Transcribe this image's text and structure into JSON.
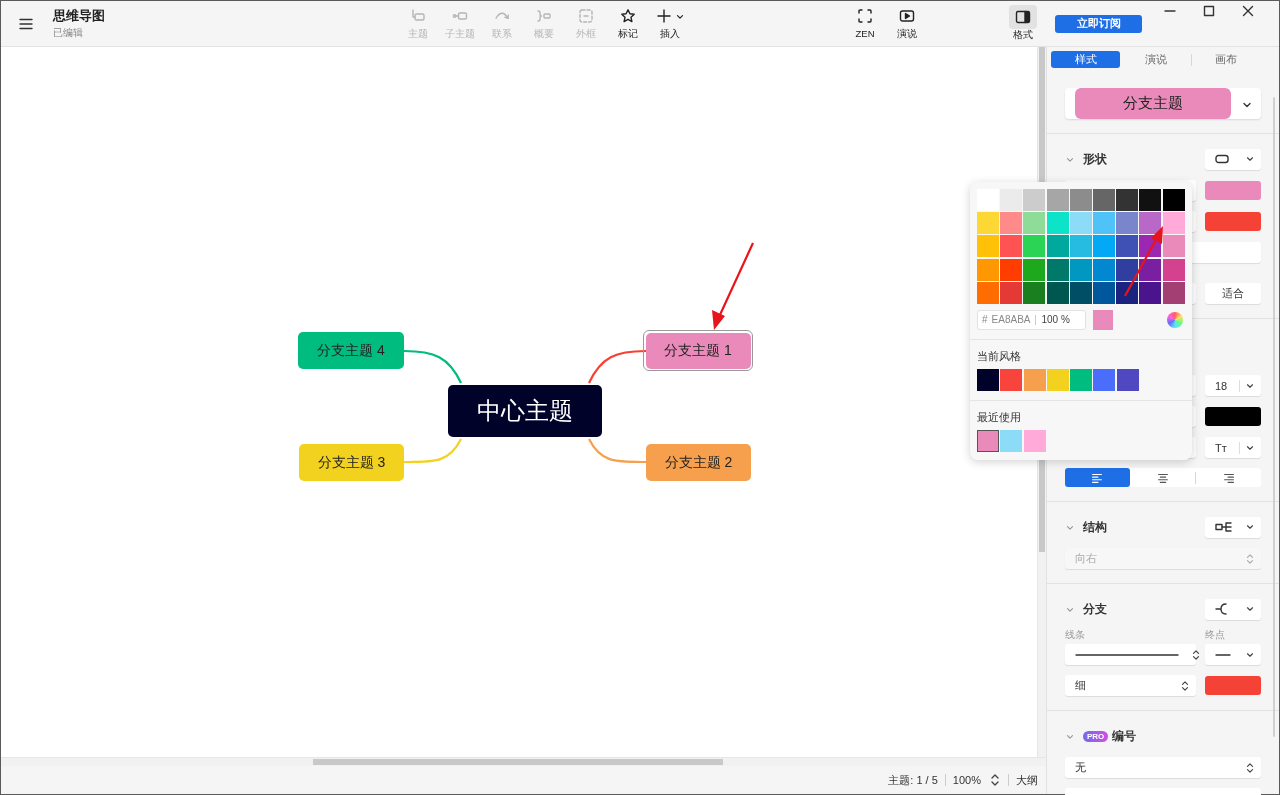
{
  "window": {
    "title": "思维导图",
    "subtitle": "已编辑"
  },
  "toolbar": [
    {
      "kind": "topic",
      "label": "主题",
      "disabled": true
    },
    {
      "kind": "subtopic",
      "label": "子主题",
      "disabled": true
    },
    {
      "kind": "relation",
      "label": "联系",
      "disabled": true
    },
    {
      "kind": "summary",
      "label": "概要",
      "disabled": true
    },
    {
      "kind": "boundary",
      "label": "外框",
      "disabled": true
    },
    {
      "kind": "marker",
      "label": "标记",
      "disabled": false
    },
    {
      "kind": "insert",
      "label": "插入",
      "disabled": false
    }
  ],
  "view_tools": [
    {
      "kind": "zen",
      "label": "ZEN"
    },
    {
      "kind": "present",
      "label": "演说"
    }
  ],
  "format_toggle": {
    "label": "格式",
    "on": true
  },
  "subscribe_button": "立即订阅",
  "canvas": {
    "central_topic": "中心主题",
    "branches": [
      {
        "text": "分支主题 4",
        "color": "#00bc7e",
        "line": {
          "color": "#00bc7e"
        },
        "selected": false
      },
      {
        "text": "分支主题 1",
        "color": "#ea8aba",
        "line": {
          "color": "#f44336"
        },
        "selected": true
      },
      {
        "text": "分支主题 3",
        "color": "#f2d21f",
        "line": {
          "color": "#f2d21f"
        },
        "selected": false
      },
      {
        "text": "分支主题 2",
        "color": "#f6a04d",
        "line": {
          "color": "#f6a04d"
        },
        "selected": false
      }
    ]
  },
  "status_bar": {
    "topics": "主题: 1 / 5",
    "zoom": "100%",
    "outline": "大纲"
  },
  "panel": {
    "tabs": [
      {
        "label": "样式",
        "selected": true
      },
      {
        "label": "演说",
        "selected": false
      },
      {
        "label": "画布",
        "selected": false
      }
    ],
    "preview": {
      "text": "分支主题",
      "color": "#ea8aba"
    },
    "shape": {
      "title": "形状",
      "fill": {
        "color": "#ea8aba"
      },
      "border": {
        "color": "#f44336"
      },
      "fit": "适合"
    },
    "text": {
      "size": "18",
      "color": "#000000",
      "case_label": "Tт"
    },
    "align": [
      {
        "kind": "left",
        "selected": true
      },
      {
        "kind": "center",
        "selected": false
      },
      {
        "kind": "right",
        "selected": false
      }
    ],
    "structure": {
      "title": "结构",
      "direction": "向右",
      "disabled": true
    },
    "branch": {
      "title": "分支",
      "line_label": "线条",
      "end_label": "终点",
      "weight": "细",
      "color": "#f44336"
    },
    "numbering": {
      "title": "编号",
      "badge": "PRO",
      "value": "无"
    }
  },
  "color_picker": {
    "grid": [
      [
        {
          "color": "#ffffff"
        },
        {
          "color": "#ebebeb"
        },
        {
          "color": "#cccccc"
        },
        {
          "color": "#a6a6a6"
        },
        {
          "color": "#8c8c8c"
        },
        {
          "color": "#666666"
        },
        {
          "color": "#333333"
        },
        {
          "color": "#111111"
        },
        {
          "color": "#000000"
        }
      ],
      [
        {
          "color": "#fdd835"
        },
        {
          "color": "#ff8a8a"
        },
        {
          "color": "#8fdc98"
        },
        {
          "color": "#0de3c8"
        },
        {
          "color": "#8ddcf7"
        },
        {
          "color": "#4fc3f7"
        },
        {
          "color": "#7986cb"
        },
        {
          "color": "#ba68c8"
        },
        {
          "color": "#ffaad8"
        }
      ],
      [
        {
          "color": "#ffc107"
        },
        {
          "color": "#ff5252"
        },
        {
          "color": "#2bd454"
        },
        {
          "color": "#00a99d"
        },
        {
          "color": "#26bbe0"
        },
        {
          "color": "#03a9f4"
        },
        {
          "color": "#3f51b5"
        },
        {
          "color": "#9c27b0"
        },
        {
          "color": "#ea8aba"
        }
      ],
      [
        {
          "color": "#ff9800"
        },
        {
          "color": "#ff3d00"
        },
        {
          "color": "#1ea81e"
        },
        {
          "color": "#00796b"
        },
        {
          "color": "#0097c1"
        },
        {
          "color": "#0288d1"
        },
        {
          "color": "#303f9f"
        },
        {
          "color": "#7b1fa2"
        },
        {
          "color": "#d4418e"
        }
      ],
      [
        {
          "color": "#ff6d00"
        },
        {
          "color": "#e53935"
        },
        {
          "color": "#1a7f1f"
        },
        {
          "color": "#00574f"
        },
        {
          "color": "#004d66"
        },
        {
          "color": "#01579b"
        },
        {
          "color": "#1a237e"
        },
        {
          "color": "#4a148c"
        },
        {
          "color": "#a43f73"
        }
      ]
    ],
    "hash": "#",
    "hex": "EA8ABA",
    "opacity": "100 %",
    "current": {
      "color": "#ea8aba"
    },
    "style_title": "当前风格",
    "style_colors": [
      {
        "color": "#000229"
      },
      {
        "color": "#f8443c"
      },
      {
        "color": "#f6a04d"
      },
      {
        "color": "#f2d21f"
      },
      {
        "color": "#00bc7e"
      },
      {
        "color": "#4a6dfc"
      },
      {
        "color": "#4f48c0"
      }
    ],
    "recent_title": "最近使用",
    "recent": [
      {
        "color": "#ea8aba",
        "selected": true
      },
      {
        "color": "#8ddcf7",
        "selected": false
      },
      {
        "color": "#ffaad8",
        "selected": false
      }
    ]
  }
}
